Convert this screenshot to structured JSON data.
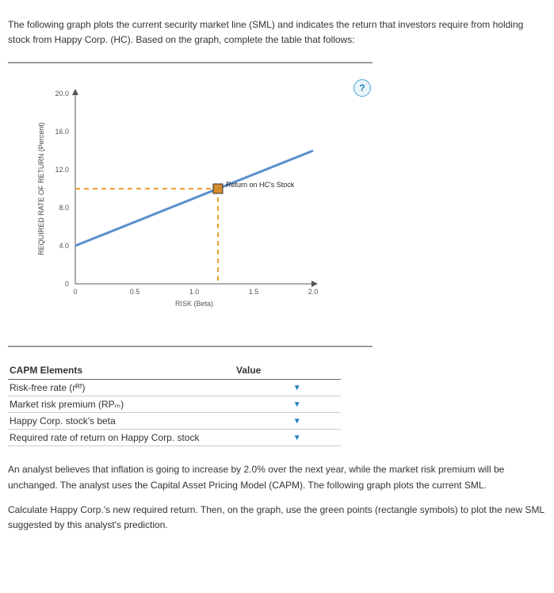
{
  "intro1": "The following graph plots the current security market line (SML) and indicates the return that investors require from holding stock from Happy Corp. (HC). Based on the graph, complete the table that follows:",
  "help_label": "?",
  "chart_data": {
    "type": "line",
    "xlabel": "RISK (Beta)",
    "ylabel": "REQUIRED RATE OF RETURN (Percent)",
    "xlim": [
      0,
      2.0
    ],
    "ylim": [
      0,
      20.0
    ],
    "x_ticks": [
      "0",
      "0.5",
      "1.0",
      "1.5",
      "2.0"
    ],
    "y_ticks": [
      "0",
      "4.0",
      "8.0",
      "12.0",
      "16.0",
      "20.0"
    ],
    "series": [
      {
        "name": "SML",
        "x": [
          0,
          2.0
        ],
        "y": [
          4.0,
          14.0
        ],
        "color": "#5a8fcf"
      }
    ],
    "point": {
      "name": "Return on HC's Stock",
      "x": 1.2,
      "y": 10.0,
      "color": "#d68a2e"
    },
    "guide_color": "#f0a030"
  },
  "table": {
    "header_elements": "CAPM Elements",
    "header_value": "Value",
    "rows": [
      {
        "label": "Risk-free rate (rᴿᶠ)",
        "value": ""
      },
      {
        "label": "Market risk premium (RPₘ)",
        "value": ""
      },
      {
        "label": "Happy Corp. stock's beta",
        "value": ""
      },
      {
        "label": "Required rate of return on Happy Corp. stock",
        "value": ""
      }
    ]
  },
  "body1": "An analyst believes that inflation is going to increase by 2.0% over the next year, while the market risk premium will be unchanged. The analyst uses the Capital Asset Pricing Model (CAPM). The following graph plots the current SML.",
  "body2": "Calculate Happy Corp.'s new required return. Then, on the graph, use the green points (rectangle symbols) to plot the new SML suggested by this analyst's prediction."
}
